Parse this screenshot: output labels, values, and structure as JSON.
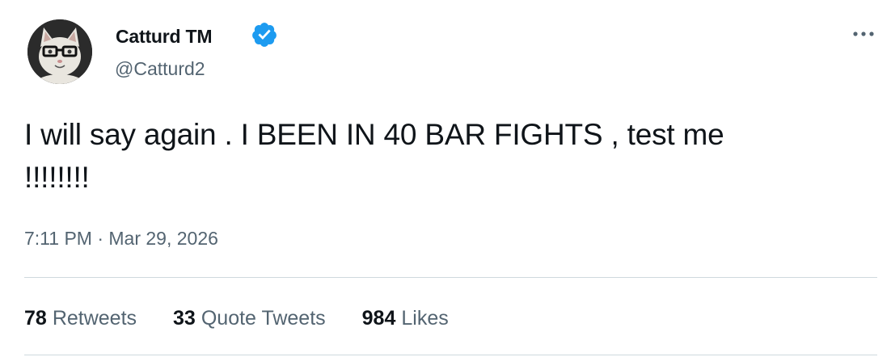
{
  "author": {
    "display_name": "Catturd TM",
    "handle": "@Catturd2",
    "verified": true,
    "avatar_icon": "cat-with-glasses-avatar"
  },
  "tweet": {
    "text_lines": [
      "I will say again . I BEEN IN 40 BAR FIGHTS , test me",
      "!!!!!!!!"
    ],
    "timestamp": "7:11 PM · Mar 29, 2026"
  },
  "stats": [
    {
      "count": "78",
      "label": "Retweets"
    },
    {
      "count": "33",
      "label": "Quote Tweets"
    },
    {
      "count": "984",
      "label": "Likes"
    }
  ],
  "colors": {
    "text_primary": "#0f1419",
    "text_secondary": "#536471",
    "verified_blue": "#1d9bf0",
    "divider": "#cfd9de"
  },
  "icons": {
    "verified": "verified-badge-icon",
    "more": "more-options-icon"
  }
}
